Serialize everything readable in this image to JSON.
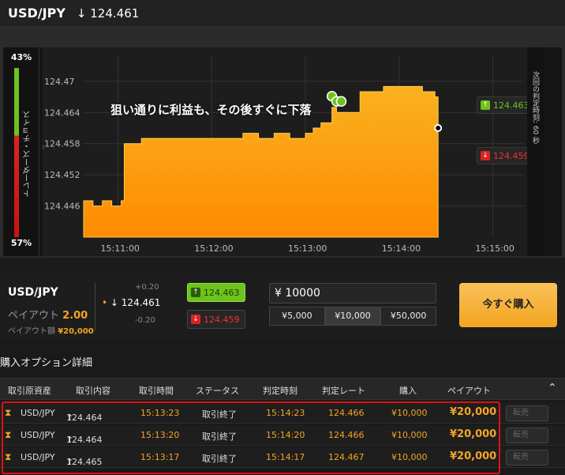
{
  "header": {
    "pair": "USD/JPY",
    "arrow": "↓",
    "price": "124.461"
  },
  "gauge": {
    "top_pct": "43%",
    "bottom_pct": "57%",
    "label": "トレーダーズ・チョイス"
  },
  "chart": {
    "annotation": "狙い通りに利益も、その後すぐに下落",
    "side_label": "次回の判定時刻: 60 秒",
    "up_tag": "124.463",
    "down_tag": "124.459",
    "colors": {
      "area": "#f7a21b",
      "up": "#6ec21d",
      "down": "#d22222"
    }
  },
  "chart_data": {
    "type": "area",
    "y_ticks": [
      "124.446",
      "124.452",
      "124.458",
      "124.464",
      "124.47"
    ],
    "x_ticks": [
      "15:11:00",
      "15:12:00",
      "15:13:00",
      "15:14:00",
      "15:15:00"
    ],
    "ylim": [
      124.44,
      124.475
    ],
    "x": [
      "15:10:38",
      "15:10:44",
      "15:10:50",
      "15:10:56",
      "15:11:02",
      "15:11:04",
      "15:11:15",
      "15:11:30",
      "15:11:45",
      "15:12:00",
      "15:12:10",
      "15:12:20",
      "15:12:30",
      "15:12:40",
      "15:12:50",
      "15:13:00",
      "15:13:05",
      "15:13:10",
      "15:13:17",
      "15:13:20",
      "15:13:23",
      "15:13:30",
      "15:13:35",
      "15:13:50",
      "15:14:05",
      "15:14:15",
      "15:14:23",
      "15:14:25"
    ],
    "y": [
      124.447,
      124.446,
      124.447,
      124.446,
      124.447,
      124.458,
      124.459,
      124.459,
      124.459,
      124.459,
      124.459,
      124.46,
      124.459,
      124.46,
      124.459,
      124.46,
      124.461,
      124.462,
      124.465,
      124.464,
      124.464,
      124.464,
      124.468,
      124.469,
      124.469,
      124.468,
      124.467,
      124.461
    ]
  },
  "trade_panel": {
    "pair": "USD/JPY",
    "payout_label": "ペイアウト",
    "payout_value": "2.00",
    "payout_amount_label": "ペイアウト額",
    "payout_amount_value": "¥20,000",
    "spread_plus": "+0.20",
    "spread_minus": "-0.20",
    "mid_price": "124.461",
    "high_price": "124.463",
    "low_price": "124.459",
    "amount": "¥ 10000",
    "amount_options": [
      "¥5,000",
      "¥10,000",
      "¥50,000"
    ],
    "buy_label": "今すぐ購入"
  },
  "details": {
    "title": "購入オプション詳細",
    "columns": [
      "取引原資産",
      "取引内容",
      "取引時間",
      "ステータス",
      "判定時刻",
      "判定レート",
      "購入",
      "ペイアウト"
    ],
    "sell_label": "転売",
    "rows": [
      {
        "asset": "USD/JPY",
        "content": "124.464",
        "time": "15:13:23",
        "status": "取引終了",
        "expiry": "15:14:23",
        "rate": "124.466",
        "purchase": "¥10,000",
        "payout": "¥20,000"
      },
      {
        "asset": "USD/JPY",
        "content": "124.464",
        "time": "15:13:20",
        "status": "取引終了",
        "expiry": "15:14:20",
        "rate": "124.466",
        "purchase": "¥10,000",
        "payout": "¥20,000"
      },
      {
        "asset": "USD/JPY",
        "content": "124.465",
        "time": "15:13:17",
        "status": "取引終了",
        "expiry": "15:14:17",
        "rate": "124.467",
        "purchase": "¥10,000",
        "payout": "¥20,000"
      }
    ]
  }
}
